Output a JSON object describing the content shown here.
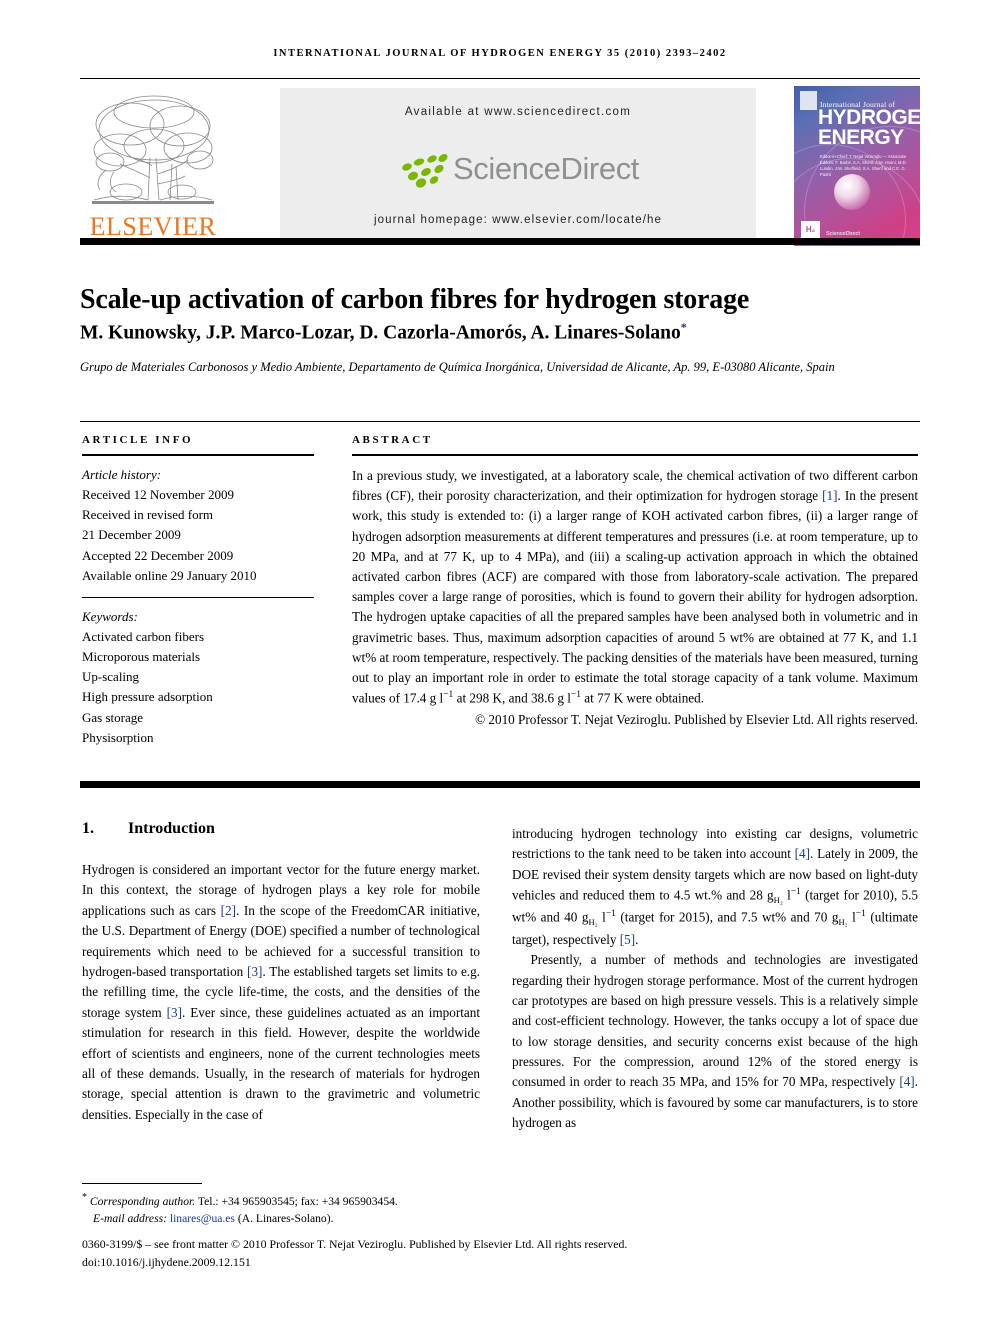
{
  "running_head": "INTERNATIONAL JOURNAL OF HYDROGEN ENERGY 35 (2010) 2393–2402",
  "masthead": {
    "publisher_wordmark": "ELSEVIER",
    "available_at": "Available at www.sciencedirect.com",
    "sciencedirect_logo_text": "ScienceDirect",
    "journal_homepage": "journal homepage: www.elsevier.com/locate/he",
    "cover": {
      "line_small": "International Journal of",
      "line_big_1": "HYDROGEN",
      "line_big_2": "ENERGY",
      "editor_block": "Editor-in-Chief: T. Nejat Veziroglu — Associate Editors: F. Barbir, S.A. Sherif, A.M. Hosni, M.D. Lundin, J.W. Sheffield, S.A. Sherif and C.E. G. Padró",
      "h2_badge": "H₂",
      "sciencedirect_mark": "ScienceDirect"
    }
  },
  "title": "Scale-up activation of carbon fibres for hydrogen storage",
  "authors": "M. Kunowsky, J.P. Marco-Lozar, D. Cazorla-Amorós, A. Linares-Solano",
  "author_star": "*",
  "affiliation": "Grupo de Materiales Carbonosos y Medio Ambiente, Departamento de Química Inorgánica, Universidad de Alicante, Ap. 99, E-03080 Alicante, Spain",
  "article_info": {
    "heading": "ARTICLE INFO",
    "history_label": "Article history:",
    "history": [
      "Received 12 November 2009",
      "Received in revised form",
      "21 December 2009",
      "Accepted 22 December 2009",
      "Available online 29 January 2010"
    ],
    "keywords_label": "Keywords:",
    "keywords": [
      "Activated carbon fibers",
      "Microporous materials",
      "Up-scaling",
      "High pressure adsorption",
      "Gas storage",
      "Physisorption"
    ]
  },
  "abstract": {
    "heading": "ABSTRACT",
    "p1_a": "In a previous study, we investigated, at a laboratory scale, the chemical activation of two different carbon fibres (CF), their porosity characterization, and their optimization for hydrogen storage ",
    "ref1": "[1]",
    "p1_b": ". In the present work, this study is extended to: (i) a larger range of KOH activated carbon fibres, (ii) a larger range of hydrogen adsorption measurements at different temperatures and pressures (i.e. at room temperature, up to 20 MPa, and at 77 K, up to 4 MPa), and (iii) a scaling-up activation approach in which the obtained activated carbon fibres (ACF) are compared with those from laboratory-scale activation. The prepared samples cover a large range of porosities, which is found to govern their ability for hydrogen adsorption. The hydrogen uptake capacities of all the prepared samples have been analysed both in volumetric and in gravimetric bases. Thus, maximum adsorption capacities of around 5 wt% are obtained at 77 K, and 1.1 wt% at room temperature, respectively. The packing densities of the materials have been measured, turning out to play an important role in order to estimate the total storage capacity of a tank volume. Maximum values of 17.4 g l",
    "exp1": "−1",
    "p1_c": " at 298 K, and 38.6 g l",
    "exp2": "−1",
    "p1_d": " at 77 K were obtained.",
    "copyright": "© 2010 Professor T. Nejat Veziroglu. Published by Elsevier Ltd. All rights reserved."
  },
  "section": {
    "number": "1.",
    "title": "Introduction"
  },
  "body_left": {
    "a": "Hydrogen is considered an important vector for the future energy market. In this context, the storage of hydrogen plays a key role for mobile applications such as cars ",
    "ref2": "[2]",
    "b": ". In the scope of the FreedomCAR initiative, the U.S. Department of Energy (DOE) specified a number of technological requirements which need to be achieved for a successful transition to hydrogen-based transportation ",
    "ref3": "[3]",
    "c": ". The established targets set limits to e.g. the refilling time, the cycle life-time, the costs, and the densities of the storage system ",
    "ref3b": "[3]",
    "d": ". Ever since, these guidelines actuated as an important stimulation for research in this field. However, despite the worldwide effort of scientists and engineers, none of the current technologies meets all of these demands. Usually, in the research of materials for hydrogen storage, special attention is drawn to the gravimetric and volumetric densities. Especially in the case of"
  },
  "body_right": {
    "p1_a": "introducing hydrogen technology into existing car designs, volumetric restrictions to the tank need to be taken into account ",
    "ref4": "[4]",
    "p1_b": ". Lately in 2009, the DOE revised their system density targets which are now based on light-duty vehicles and reduced them to 4.5 wt.% and 28 g",
    "sub1": "H₂",
    "p1_c": " l",
    "exp1": "−1",
    "p1_d": " (target for 2010), 5.5 wt% and 40 g",
    "sub2": "H₂",
    "p1_e": " l",
    "exp2": "−1",
    "p1_f": " (target for 2015), and 7.5 wt% and 70 g",
    "sub3": "H₂",
    "p1_g": " l",
    "exp3": "−1",
    "p1_h": " (ultimate target), respectively ",
    "ref5": "[5]",
    "p1_i": ".",
    "p2_a": "Presently, a number of methods and technologies are investigated regarding their hydrogen storage performance. Most of the current hydrogen car prototypes are based on high pressure vessels. This is a relatively simple and cost-efficient technology. However, the tanks occupy a lot of space due to low storage densities, and security concerns exist because of the high pressures. For the compression, around 12% of the stored energy is consumed in order to reach 35 MPa, and 15% for 70 MPa, respectively ",
    "ref4b": "[4]",
    "p2_b": ". Another possibility, which is favoured by some car manufacturers, is to store hydrogen as"
  },
  "footnote": {
    "star": "*",
    "corresponding": "Corresponding author.",
    "tel": " Tel.: +34 965903545; fax: +34 965903454.",
    "email_label": "E-mail address: ",
    "email": "linares@ua.es",
    "email_owner": " (A. Linares-Solano)."
  },
  "imprint": {
    "line1": "0360-3199/$ – see front matter © 2010 Professor T. Nejat Veziroglu. Published by Elsevier Ltd. All rights reserved.",
    "line2": "doi:10.1016/j.ijhydene.2009.12.151"
  },
  "colors": {
    "elsevier_orange": "#E87722",
    "link_blue": "#1a3a8f",
    "sciencedirect_green": "#7AB800",
    "banner_gray": "#EDEDED"
  }
}
